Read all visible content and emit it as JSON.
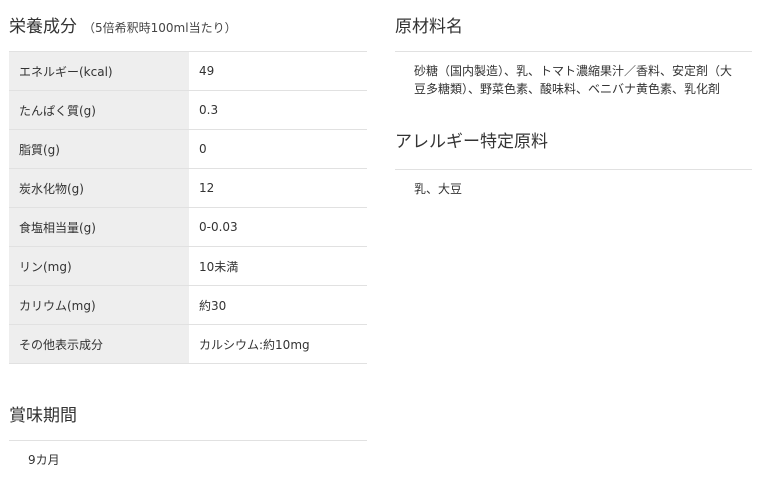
{
  "nutrition": {
    "title": "栄養成分",
    "note": "（5倍希釈時100ml当たり）",
    "rows": [
      {
        "label": "エネルギー(kcal)",
        "value": "49"
      },
      {
        "label": "たんぱく質(g)",
        "value": "0.3"
      },
      {
        "label": "脂質(g)",
        "value": "0"
      },
      {
        "label": "炭水化物(g)",
        "value": "12"
      },
      {
        "label": "食塩相当量(g)",
        "value": "0-0.03"
      },
      {
        "label": "リン(mg)",
        "value": "10未満"
      },
      {
        "label": "カリウム(mg)",
        "value": "約30"
      },
      {
        "label": "その他表示成分",
        "value": "カルシウム:約10mg"
      }
    ]
  },
  "shelf_life": {
    "title": "賞味期間",
    "value": "9カ月"
  },
  "ingredients": {
    "title": "原材料名",
    "text": "砂糖（国内製造）、乳、トマト濃縮果汁／香料、安定剤（大豆多糖類）、野菜色素、酸味料、ベニバナ黄色素、乳化剤"
  },
  "allergens": {
    "title": "アレルギー特定原料",
    "text": "乳、大豆"
  }
}
